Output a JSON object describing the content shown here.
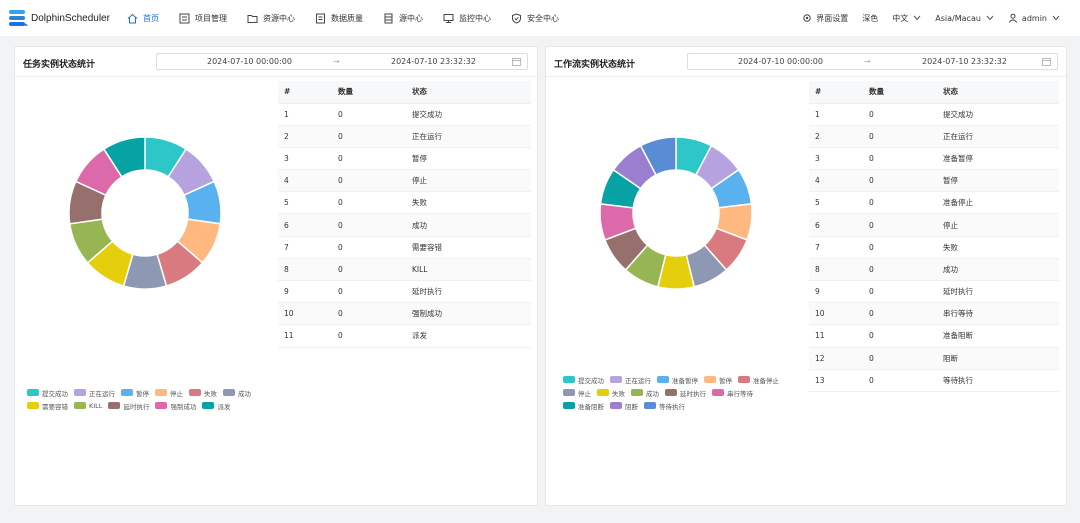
{
  "app": {
    "logo_text": "DolphinScheduler"
  },
  "nav": [
    {
      "label": "首页",
      "icon": "home-icon",
      "active": true
    },
    {
      "label": "项目管理",
      "icon": "project-icon"
    },
    {
      "label": "资源中心",
      "icon": "folder-icon"
    },
    {
      "label": "数据质量",
      "icon": "data-quality-icon"
    },
    {
      "label": "源中心",
      "icon": "datasource-icon"
    },
    {
      "label": "监控中心",
      "icon": "monitor-icon"
    },
    {
      "label": "安全中心",
      "icon": "shield-icon"
    }
  ],
  "tools": {
    "ui_settings": "界面设置",
    "theme": "深色",
    "language": "中文",
    "timezone": "Asia/Macau",
    "user": "admin"
  },
  "colors": {
    "accent": "#1d6fe6",
    "palette": [
      "#2ec7c9",
      "#b6a2de",
      "#5ab1ef",
      "#ffb980",
      "#d87a80",
      "#8d98b3",
      "#e5cf0d",
      "#97b552",
      "#95706d",
      "#dc69aa",
      "#07a2a4",
      "#9a7fd1",
      "#588dd5"
    ]
  },
  "task_panel": {
    "title": "任务实例状态统计",
    "date_start": "2024-07-10 00:00:00",
    "date_end": "2024-07-10 23:32:32",
    "columns": [
      "#",
      "数量",
      "状态"
    ],
    "rows": [
      {
        "idx": "1",
        "count": "0",
        "state": "提交成功"
      },
      {
        "idx": "2",
        "count": "0",
        "state": "正在运行"
      },
      {
        "idx": "3",
        "count": "0",
        "state": "暂停"
      },
      {
        "idx": "4",
        "count": "0",
        "state": "停止"
      },
      {
        "idx": "5",
        "count": "0",
        "state": "失败"
      },
      {
        "idx": "6",
        "count": "0",
        "state": "成功"
      },
      {
        "idx": "7",
        "count": "0",
        "state": "需要容错"
      },
      {
        "idx": "8",
        "count": "0",
        "state": "KILL"
      },
      {
        "idx": "9",
        "count": "0",
        "state": "延时执行"
      },
      {
        "idx": "10",
        "count": "0",
        "state": "强制成功"
      },
      {
        "idx": "11",
        "count": "0",
        "state": "派发"
      }
    ],
    "legend": [
      "提交成功",
      "正在运行",
      "暂停",
      "停止",
      "失败",
      "成功",
      "需要容错",
      "KILL",
      "延时执行",
      "强制成功",
      "派发"
    ],
    "legend_colors": [
      "#2ec7c9",
      "#b6a2de",
      "#5ab1ef",
      "#ffb980",
      "#d87a80",
      "#8d98b3",
      "#e5cf0d",
      "#97b552",
      "#95706d",
      "#dc69aa",
      "#07a2a4"
    ]
  },
  "workflow_panel": {
    "title": "工作流实例状态统计",
    "date_start": "2024-07-10 00:00:00",
    "date_end": "2024-07-10 23:32:32",
    "columns": [
      "#",
      "数量",
      "状态"
    ],
    "rows": [
      {
        "idx": "1",
        "count": "0",
        "state": "提交成功"
      },
      {
        "idx": "2",
        "count": "0",
        "state": "正在运行"
      },
      {
        "idx": "3",
        "count": "0",
        "state": "准备暂停"
      },
      {
        "idx": "4",
        "count": "0",
        "state": "暂停"
      },
      {
        "idx": "5",
        "count": "0",
        "state": "准备停止"
      },
      {
        "idx": "6",
        "count": "0",
        "state": "停止"
      },
      {
        "idx": "7",
        "count": "0",
        "state": "失败"
      },
      {
        "idx": "8",
        "count": "0",
        "state": "成功"
      },
      {
        "idx": "9",
        "count": "0",
        "state": "延时执行"
      },
      {
        "idx": "10",
        "count": "0",
        "state": "串行等待"
      },
      {
        "idx": "11",
        "count": "0",
        "state": "准备阻断"
      },
      {
        "idx": "12",
        "count": "0",
        "state": "阻断"
      },
      {
        "idx": "13",
        "count": "0",
        "state": "等待执行"
      }
    ],
    "legend": [
      "提交成功",
      "正在运行",
      "准备暂停",
      "暂停",
      "准备停止",
      "停止",
      "失败",
      "成功",
      "延时执行",
      "串行等待",
      "准备阻断",
      "阻断",
      "等待执行"
    ],
    "legend_colors": [
      "#2ec7c9",
      "#b6a2de",
      "#5ab1ef",
      "#ffb980",
      "#d87a80",
      "#8d98b3",
      "#e5cf0d",
      "#97b552",
      "#95706d",
      "#dc69aa",
      "#07a2a4",
      "#9a7fd1",
      "#588dd5"
    ]
  },
  "chart_data": [
    {
      "type": "pie",
      "categories": [
        "提交成功",
        "正在运行",
        "暂停",
        "停止",
        "失败",
        "成功",
        "需要容错",
        "KILL",
        "延时执行",
        "强制成功",
        "派发"
      ],
      "values": [
        0,
        0,
        0,
        0,
        0,
        0,
        0,
        0,
        0,
        0,
        0
      ],
      "legend": "bottom-left"
    },
    {
      "type": "pie",
      "categories": [
        "提交成功",
        "正在运行",
        "准备暂停",
        "暂停",
        "准备停止",
        "停止",
        "失败",
        "成功",
        "延时执行",
        "串行等待",
        "准备阻断",
        "阻断",
        "等待执行"
      ],
      "values": [
        0,
        0,
        0,
        0,
        0,
        0,
        0,
        0,
        0,
        0,
        0,
        0,
        0
      ],
      "legend": "bottom-left"
    }
  ]
}
